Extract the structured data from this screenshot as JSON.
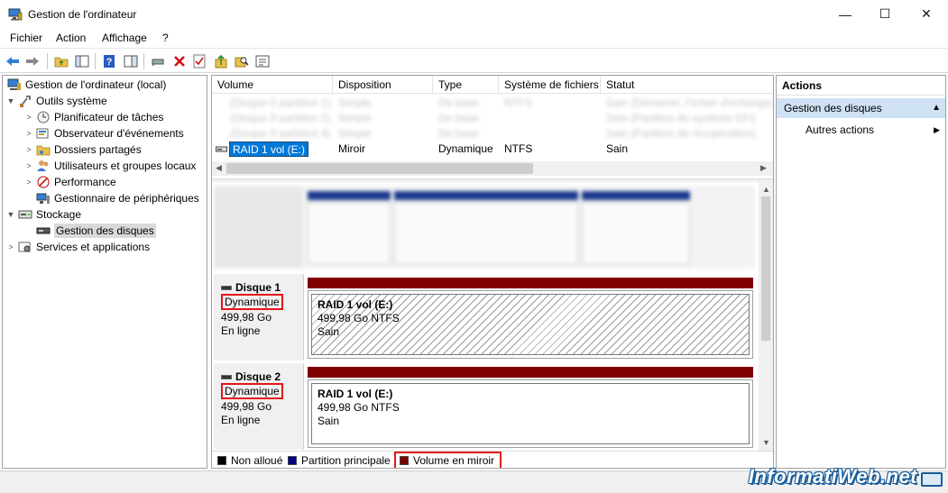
{
  "window": {
    "title": "Gestion de l'ordinateur",
    "min_glyph": "—",
    "max_glyph": "☐",
    "close_glyph": "✕"
  },
  "menu": [
    "Fichier",
    "Action",
    "Affichage",
    "?"
  ],
  "tree": [
    {
      "label": "Gestion de l'ordinateur (local)",
      "icon": "computer-management-icon"
    },
    {
      "label": "Outils système",
      "icon": "system-tools-icon"
    },
    {
      "label": "Planificateur de tâches",
      "icon": "task-scheduler-icon"
    },
    {
      "label": "Observateur d'événements",
      "icon": "event-viewer-icon"
    },
    {
      "label": "Dossiers partagés",
      "icon": "shared-folders-icon"
    },
    {
      "label": "Utilisateurs et groupes locaux",
      "icon": "users-groups-icon"
    },
    {
      "label": "Performance",
      "icon": "performance-icon"
    },
    {
      "label": "Gestionnaire de périphériques",
      "icon": "device-manager-icon"
    },
    {
      "label": "Stockage",
      "icon": "storage-icon"
    },
    {
      "label": "Gestion des disques",
      "icon": "disk-management-icon"
    },
    {
      "label": "Services et applications",
      "icon": "services-icon"
    }
  ],
  "volume_list": {
    "headers": [
      "Volume",
      "Disposition",
      "Type",
      "Système de fichiers",
      "Statut"
    ],
    "blurred_rows": [
      [
        "(Disque 0 partition 1)",
        "Simple",
        "De base",
        "NTFS",
        "Sain (Démarrer, Fichier d'échange)"
      ],
      [
        "(Disque 0 partition 2)",
        "Simple",
        "De base",
        "",
        "Sain (Partition du système EFI)"
      ],
      [
        "(Disque 0 partition 4)",
        "Simple",
        "De base",
        "",
        "Sain (Partition de récupération)"
      ]
    ],
    "row": {
      "volume": "RAID 1 vol (E:)",
      "layout": "Miroir",
      "type": "Dynamique",
      "fs": "NTFS",
      "status": "Sain"
    }
  },
  "disks": [
    {
      "name": "Disque 1",
      "kind": "Dynamique",
      "size": "499,98 Go",
      "state": "En ligne",
      "vol_name": "RAID 1 vol  (E:)",
      "vol_size": "499,98 Go NTFS",
      "vol_status": "Sain"
    },
    {
      "name": "Disque 2",
      "kind": "Dynamique",
      "size": "499,98 Go",
      "state": "En ligne",
      "vol_name": "RAID 1 vol  (E:)",
      "vol_size": "499,98 Go NTFS",
      "vol_status": "Sain"
    }
  ],
  "legend": [
    {
      "label": "Non alloué",
      "color": "#000000"
    },
    {
      "label": "Partition principale",
      "color": "#00008b"
    },
    {
      "label": "Volume en miroir",
      "color": "#800000"
    }
  ],
  "actions": {
    "title": "Actions",
    "section": "Gestion des disques",
    "item": "Autres actions"
  },
  "watermark": "InformatiWeb.net",
  "colors": {
    "mirror": "#800000",
    "highlight_box": "#e8141c",
    "action_section": "#cfe2f3"
  }
}
